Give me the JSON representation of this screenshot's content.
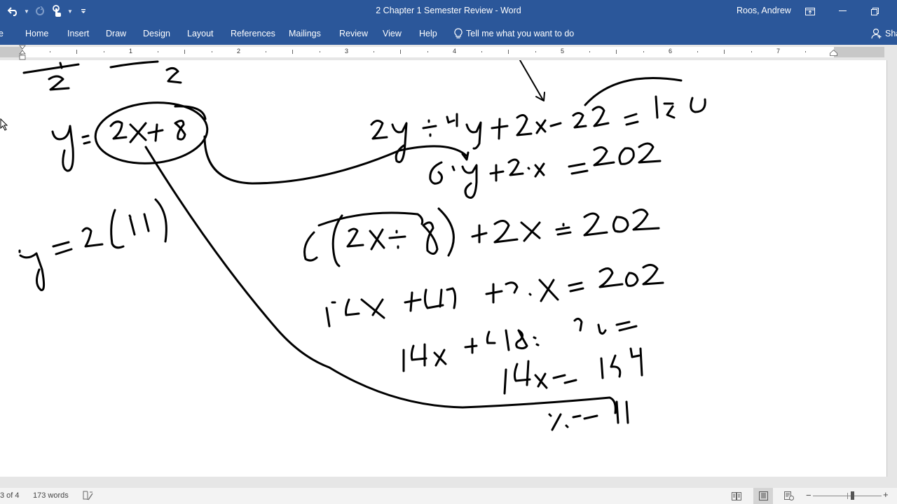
{
  "app": {
    "document_title": "2 Chapter 1 Semester Review  -  Word",
    "user_name": "Roos, Andrew"
  },
  "quick_access": {
    "undo": "undo-icon",
    "redo": "redo-icon",
    "touch_mode": "touch-mode-icon",
    "customize": "customize-qat-icon"
  },
  "ribbon": {
    "partial_tab": "e",
    "tabs": [
      "Home",
      "Insert",
      "Draw",
      "Design",
      "Layout",
      "References",
      "Mailings",
      "Review",
      "View",
      "Help"
    ],
    "tell_me": "Tell me what you want to do",
    "share": "Sha"
  },
  "ruler": {
    "numbers": [
      "1",
      "2",
      "3",
      "4",
      "5",
      "6",
      "7"
    ]
  },
  "document": {
    "ink_content": [
      "fraction fragments ending in /2 and /2",
      "y = (2x + 8)  [circled]",
      "y = 2(11)",
      "2y + 4y + 2x - 22 = 180",
      "6y + 2x = 202",
      "6(2x + 8) + 2x = 202",
      "12x + 48 + 2x = 202",
      "14x + 48 = 202",
      "14x = 154",
      "x = 11"
    ],
    "ink_color": "#000000"
  },
  "statusbar": {
    "page": "3 of 4",
    "words": "173 words",
    "zoom_slider_fraction": 0.57
  },
  "colors": {
    "ribbon_blue": "#2b579a",
    "workspace_gray": "#e6e6e6",
    "status_bg": "#f3f3f3"
  }
}
